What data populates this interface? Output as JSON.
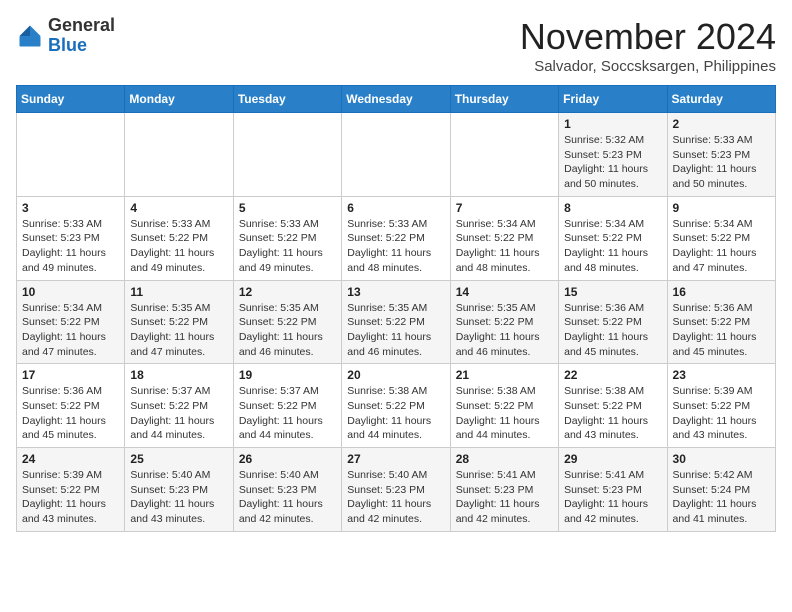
{
  "header": {
    "logo": {
      "general": "General",
      "blue": "Blue"
    },
    "month": "November 2024",
    "location": "Salvador, Soccsksargen, Philippines"
  },
  "days_of_week": [
    "Sunday",
    "Monday",
    "Tuesday",
    "Wednesday",
    "Thursday",
    "Friday",
    "Saturday"
  ],
  "weeks": [
    [
      {
        "day": "",
        "info": ""
      },
      {
        "day": "",
        "info": ""
      },
      {
        "day": "",
        "info": ""
      },
      {
        "day": "",
        "info": ""
      },
      {
        "day": "",
        "info": ""
      },
      {
        "day": "1",
        "info": "Sunrise: 5:32 AM\nSunset: 5:23 PM\nDaylight: 11 hours and 50 minutes."
      },
      {
        "day": "2",
        "info": "Sunrise: 5:33 AM\nSunset: 5:23 PM\nDaylight: 11 hours and 50 minutes."
      }
    ],
    [
      {
        "day": "3",
        "info": "Sunrise: 5:33 AM\nSunset: 5:23 PM\nDaylight: 11 hours and 49 minutes."
      },
      {
        "day": "4",
        "info": "Sunrise: 5:33 AM\nSunset: 5:22 PM\nDaylight: 11 hours and 49 minutes."
      },
      {
        "day": "5",
        "info": "Sunrise: 5:33 AM\nSunset: 5:22 PM\nDaylight: 11 hours and 49 minutes."
      },
      {
        "day": "6",
        "info": "Sunrise: 5:33 AM\nSunset: 5:22 PM\nDaylight: 11 hours and 48 minutes."
      },
      {
        "day": "7",
        "info": "Sunrise: 5:34 AM\nSunset: 5:22 PM\nDaylight: 11 hours and 48 minutes."
      },
      {
        "day": "8",
        "info": "Sunrise: 5:34 AM\nSunset: 5:22 PM\nDaylight: 11 hours and 48 minutes."
      },
      {
        "day": "9",
        "info": "Sunrise: 5:34 AM\nSunset: 5:22 PM\nDaylight: 11 hours and 47 minutes."
      }
    ],
    [
      {
        "day": "10",
        "info": "Sunrise: 5:34 AM\nSunset: 5:22 PM\nDaylight: 11 hours and 47 minutes."
      },
      {
        "day": "11",
        "info": "Sunrise: 5:35 AM\nSunset: 5:22 PM\nDaylight: 11 hours and 47 minutes."
      },
      {
        "day": "12",
        "info": "Sunrise: 5:35 AM\nSunset: 5:22 PM\nDaylight: 11 hours and 46 minutes."
      },
      {
        "day": "13",
        "info": "Sunrise: 5:35 AM\nSunset: 5:22 PM\nDaylight: 11 hours and 46 minutes."
      },
      {
        "day": "14",
        "info": "Sunrise: 5:35 AM\nSunset: 5:22 PM\nDaylight: 11 hours and 46 minutes."
      },
      {
        "day": "15",
        "info": "Sunrise: 5:36 AM\nSunset: 5:22 PM\nDaylight: 11 hours and 45 minutes."
      },
      {
        "day": "16",
        "info": "Sunrise: 5:36 AM\nSunset: 5:22 PM\nDaylight: 11 hours and 45 minutes."
      }
    ],
    [
      {
        "day": "17",
        "info": "Sunrise: 5:36 AM\nSunset: 5:22 PM\nDaylight: 11 hours and 45 minutes."
      },
      {
        "day": "18",
        "info": "Sunrise: 5:37 AM\nSunset: 5:22 PM\nDaylight: 11 hours and 44 minutes."
      },
      {
        "day": "19",
        "info": "Sunrise: 5:37 AM\nSunset: 5:22 PM\nDaylight: 11 hours and 44 minutes."
      },
      {
        "day": "20",
        "info": "Sunrise: 5:38 AM\nSunset: 5:22 PM\nDaylight: 11 hours and 44 minutes."
      },
      {
        "day": "21",
        "info": "Sunrise: 5:38 AM\nSunset: 5:22 PM\nDaylight: 11 hours and 44 minutes."
      },
      {
        "day": "22",
        "info": "Sunrise: 5:38 AM\nSunset: 5:22 PM\nDaylight: 11 hours and 43 minutes."
      },
      {
        "day": "23",
        "info": "Sunrise: 5:39 AM\nSunset: 5:22 PM\nDaylight: 11 hours and 43 minutes."
      }
    ],
    [
      {
        "day": "24",
        "info": "Sunrise: 5:39 AM\nSunset: 5:22 PM\nDaylight: 11 hours and 43 minutes."
      },
      {
        "day": "25",
        "info": "Sunrise: 5:40 AM\nSunset: 5:23 PM\nDaylight: 11 hours and 43 minutes."
      },
      {
        "day": "26",
        "info": "Sunrise: 5:40 AM\nSunset: 5:23 PM\nDaylight: 11 hours and 42 minutes."
      },
      {
        "day": "27",
        "info": "Sunrise: 5:40 AM\nSunset: 5:23 PM\nDaylight: 11 hours and 42 minutes."
      },
      {
        "day": "28",
        "info": "Sunrise: 5:41 AM\nSunset: 5:23 PM\nDaylight: 11 hours and 42 minutes."
      },
      {
        "day": "29",
        "info": "Sunrise: 5:41 AM\nSunset: 5:23 PM\nDaylight: 11 hours and 42 minutes."
      },
      {
        "day": "30",
        "info": "Sunrise: 5:42 AM\nSunset: 5:24 PM\nDaylight: 11 hours and 41 minutes."
      }
    ]
  ]
}
